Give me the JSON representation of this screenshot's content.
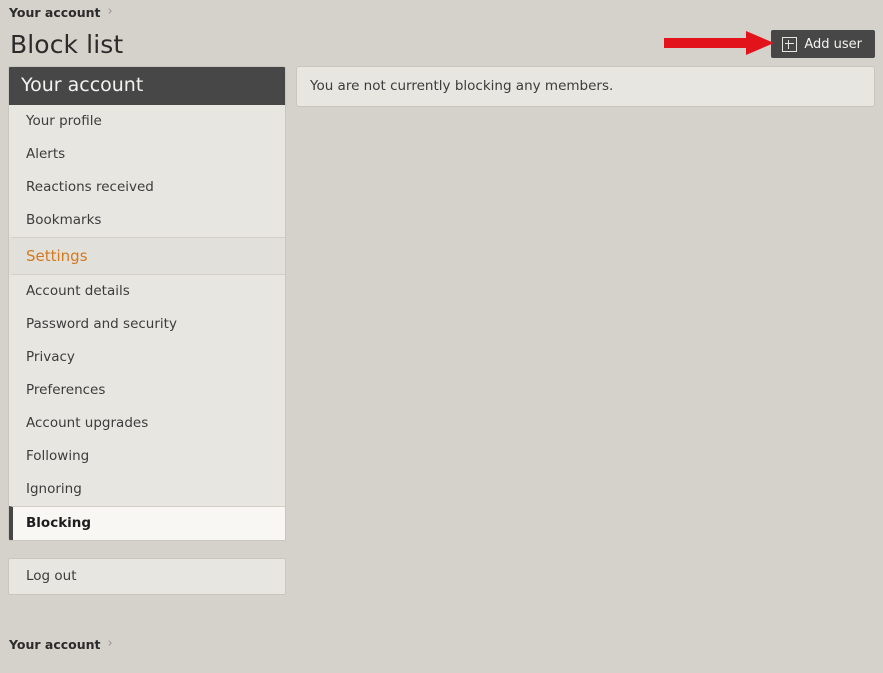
{
  "breadcrumb_top": {
    "link_label": "Your account",
    "separator": "›"
  },
  "header": {
    "page_title": "Block list",
    "add_user_label": "Add user",
    "add_user_icon": "plus-square-icon",
    "annotation_icon": "red-arrow-pointer"
  },
  "sidebar": {
    "header_label": "Your account",
    "items": [
      {
        "label": "Your profile",
        "type": "link",
        "active": false
      },
      {
        "label": "Alerts",
        "type": "link",
        "active": false
      },
      {
        "label": "Reactions received",
        "type": "link",
        "active": false
      },
      {
        "label": "Bookmarks",
        "type": "link",
        "active": false
      },
      {
        "label": "Settings",
        "type": "section",
        "active": false
      },
      {
        "label": "Account details",
        "type": "link",
        "active": false
      },
      {
        "label": "Password and security",
        "type": "link",
        "active": false
      },
      {
        "label": "Privacy",
        "type": "link",
        "active": false
      },
      {
        "label": "Preferences",
        "type": "link",
        "active": false
      },
      {
        "label": "Account upgrades",
        "type": "link",
        "active": false
      },
      {
        "label": "Following",
        "type": "link",
        "active": false
      },
      {
        "label": "Ignoring",
        "type": "link",
        "active": false
      },
      {
        "label": "Blocking",
        "type": "link",
        "active": true
      }
    ],
    "logout_label": "Log out"
  },
  "main": {
    "notice_text": "You are not currently blocking any members."
  },
  "breadcrumb_bottom": {
    "link_label": "Your account",
    "separator": "›"
  },
  "colors": {
    "page_background": "#d5d2cb",
    "panel_background": "#e8e6e1",
    "panel_border": "#c9c6bf",
    "header_dark": "#474747",
    "accent_orange": "#d2791d",
    "active_background": "#f8f7f4",
    "annotation_red": "#e3131b",
    "text_primary": "#3c3c3c"
  }
}
